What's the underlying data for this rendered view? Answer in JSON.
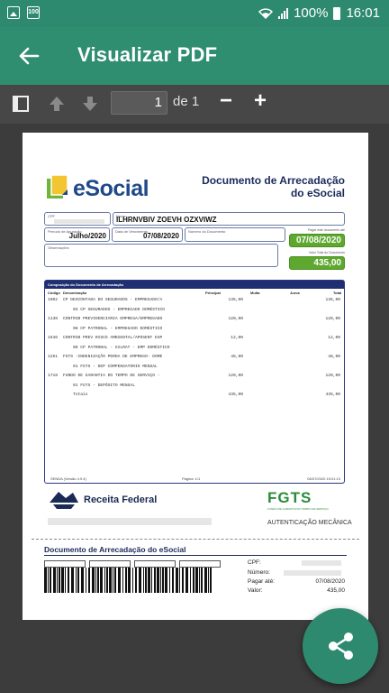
{
  "status": {
    "battery_text": "100%",
    "time": "16:01",
    "calendar_icon_text": "100"
  },
  "appbar": {
    "title": "Visualizar PDF"
  },
  "toolbar": {
    "current_page": "1",
    "page_total": "de 1",
    "zoom_out": "−",
    "zoom_in": "+"
  },
  "document": {
    "logo_text": "eSocial",
    "title_line1": "Documento de Arrecadação",
    "title_line2": "do eSocial",
    "cpf_label": "CPF",
    "nome_label": "Nome",
    "nome_value": "ILHRNVBIV ZOEVH OZXVIWZ",
    "periodo_label": "Período de Apuração",
    "periodo_value": "Julho/2020",
    "vencimento_label": "Data de Vencimento",
    "vencimento_value": "07/08/2020",
    "numero_label": "Número do Documento",
    "pagar_label": "Pagar este documento até",
    "pagar_value": "07/08/2020",
    "valor_label": "Valor Total do Documento",
    "valor_value": "435,00",
    "obs_label": "Observações",
    "comp_title": "Composição do Documento de Arrecadação",
    "col_codigo": "Código",
    "col_denominacao": "Denominação",
    "col_principal": "Principal",
    "col_multa": "Multa",
    "col_juros": "Juros",
    "col_total": "Total",
    "rows": [
      {
        "codigo": "1002",
        "desc": "CP DESCONTADA DO SEGURADOS - EMPREGADO/A",
        "principal": "135,00",
        "total": "135,00"
      },
      {
        "codigo": "",
        "desc": "    03 CP SEGURADOS - EMPREGADO DOMÉSTICO",
        "principal": "",
        "total": ""
      },
      {
        "codigo": "1138",
        "desc": "CONTRIB PREVIDENCIARIA EMPRESA/EMPREGADO",
        "principal": "120,00",
        "total": "120,00"
      },
      {
        "codigo": "",
        "desc": "    08 CP PATRONAL - EMPREGADO DOMÉSTICO",
        "principal": "",
        "total": ""
      },
      {
        "codigo": "1646",
        "desc": "CONTRIB PREV RISCO AMBIENTAL/APOSENT ESP",
        "principal": "12,00",
        "total": "12,00"
      },
      {
        "codigo": "",
        "desc": "    09 CP PATRONAL - GILRAT - EMP DOMÉSTICO",
        "principal": "",
        "total": ""
      },
      {
        "codigo": "1251",
        "desc": "FGTS -INDENIZAÇÃO PERDA DE EMPREGO- DOMÉ",
        "principal": "48,00",
        "total": "48,00"
      },
      {
        "codigo": "",
        "desc": "    01 FGTS - DEP COMPENSATORIO MENSAL",
        "principal": "",
        "total": ""
      },
      {
        "codigo": "1718",
        "desc": "FUNDO DE GARANTIA DO TEMPO DE SERVIÇO -",
        "principal": "120,00",
        "total": "120,00"
      },
      {
        "codigo": "",
        "desc": "    01 FGTS - DEPÓSITO MENSAL",
        "principal": "",
        "total": ""
      },
      {
        "codigo": "",
        "desc": "    Totais",
        "principal": "435,00",
        "total": "435,00"
      }
    ],
    "footer_left": "SENDA (Versão 4.9.4)",
    "footer_mid": "Página:  1/1",
    "footer_right": "06/07/2020 15:01:13",
    "rf_text": "Receita Federal",
    "fgts_text": "FGTS",
    "fgts_sub": "FUNDO DE GARANTIA DO TEMPO DE SERVIÇO",
    "auth_text": "AUTENTICAÇÃO MECÂNICA",
    "stub_title": "Documento de Arrecadação do eSocial",
    "stub_cpf_label": "CPF:",
    "stub_numero_label": "Número:",
    "stub_pagar_label": "Pagar até:",
    "stub_pagar_value": "07/08/2020",
    "stub_valor_label": "Valor:",
    "stub_valor_value": "435,00"
  }
}
